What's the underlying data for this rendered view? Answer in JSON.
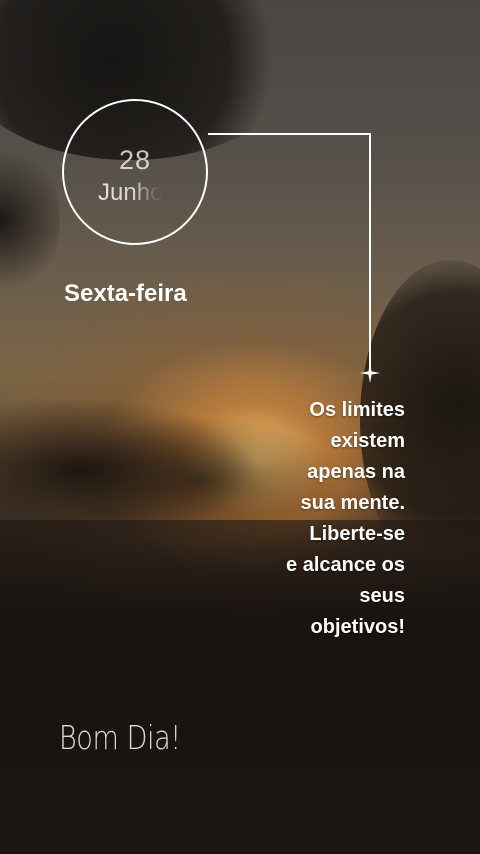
{
  "date": {
    "day": "28",
    "month": "Junho"
  },
  "weekday": "Sexta-feira",
  "quote_lines": [
    "Os limites",
    "existem",
    "apenas na",
    "sua mente.",
    "Liberte-se",
    "e alcance os",
    "seus",
    "objetivos!"
  ],
  "greeting": "Bom Dia!",
  "icons": {
    "sparkle": "four-point-star-icon"
  },
  "colors": {
    "text": "#ffffff",
    "sun": "#ffcd78"
  }
}
